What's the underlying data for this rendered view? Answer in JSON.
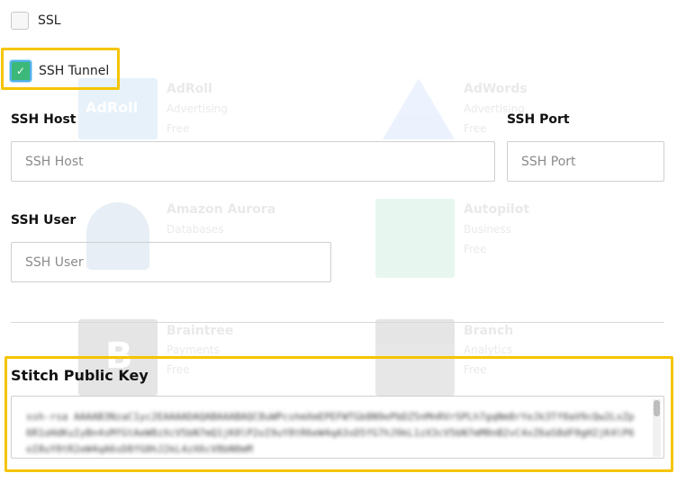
{
  "catalog": {
    "tiles": [
      {
        "name": "AdRoll",
        "category": "Advertising",
        "tier": "Free",
        "logo_text": "AdRoll",
        "color": "#1a7fd6"
      },
      {
        "name": "AdWords",
        "category": "Advertising",
        "tier": "Free",
        "color": "#4285f4"
      },
      {
        "name": "Amazon Aurora",
        "category": "Databases",
        "tier": "",
        "color": "#1f5fa8"
      },
      {
        "name": "Autopilot",
        "category": "Business",
        "tier": "Free",
        "color": "#1fb57a"
      },
      {
        "name": "Braintree",
        "category": "Payments",
        "tier": "Free",
        "logo_text": "B",
        "color": "#111111"
      },
      {
        "name": "Branch",
        "category": "Analytics",
        "tier": "Free",
        "color": "#111111"
      }
    ]
  },
  "form": {
    "ssl": {
      "label": "SSL",
      "checked": false
    },
    "ssh_tunnel": {
      "label": "SSH Tunnel",
      "checked": true,
      "check_glyph": "✓"
    },
    "ssh_host": {
      "label": "SSH Host",
      "placeholder": "SSH Host",
      "value": ""
    },
    "ssh_port": {
      "label": "SSH Port",
      "placeholder": "SSH Port",
      "value": ""
    },
    "ssh_user": {
      "label": "SSH User",
      "placeholder": "SSH User",
      "value": ""
    },
    "public_key": {
      "label": "Stitch Public Key",
      "value": "ssh-rsa AAAAB3NzaC1yc2EAAAADAQABAAABAQC8uWPcshmXmEPEFWTGb8N9ePbDZ5nMnRVrSPLh7gqNm8rYeJk3Tf0aV9cQw2LxZp6R1oHdKuIyBn4sMfGtAeW8zXcV5bN7mQ1jK0lP2oI9uY8tR6eW4qA3sD5fG7hJ9kL1zX3cV5bN7mM0nB2vC4xZ6aS8dF0gH2jK4lP6oI8uY0tR2eW4qA6sD8fG0hJ2kL4zX6cV8bN0mM"
    },
    "colors": {
      "highlight": "#f5c400",
      "checkbox_checked": "#3cb878",
      "checkbox_focus": "#4fb0e8"
    }
  }
}
